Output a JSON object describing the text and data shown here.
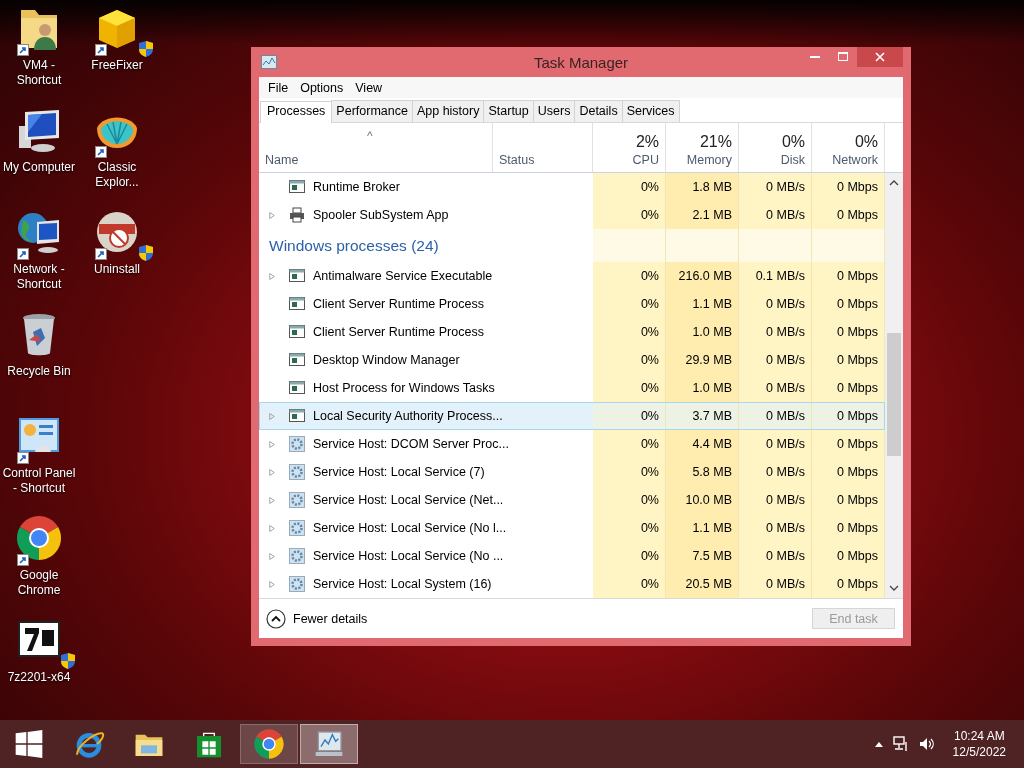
{
  "desktop_icons": [
    {
      "label": "VM4 - Shortcut",
      "kind": "user-folder",
      "shortcut": true,
      "shield": false
    },
    {
      "label": "My Computer",
      "kind": "computer",
      "shortcut": false,
      "shield": false
    },
    {
      "label": "Network - Shortcut",
      "kind": "network",
      "shortcut": true,
      "shield": false
    },
    {
      "label": "Recycle Bin",
      "kind": "recycle-bin",
      "shortcut": false,
      "shield": false
    },
    {
      "label": "Control Panel - Shortcut",
      "kind": "control-panel",
      "shortcut": true,
      "shield": false
    },
    {
      "label": "Google Chrome",
      "kind": "chrome",
      "shortcut": true,
      "shield": false
    },
    {
      "label": "7z2201-x64",
      "kind": "archive",
      "shortcut": false,
      "shield": true
    },
    {
      "label": "FreeFixer",
      "kind": "box-app",
      "shortcut": true,
      "shield": true
    },
    {
      "label": "Classic Explor...",
      "kind": "shell",
      "shortcut": true,
      "shield": false
    },
    {
      "label": "Uninstall",
      "kind": "installer",
      "shortcut": true,
      "shield": true
    }
  ],
  "window": {
    "title": "Task Manager",
    "menu": [
      "File",
      "Options",
      "View"
    ],
    "tabs": [
      {
        "label": "Processes",
        "selected": true
      },
      {
        "label": "Performance",
        "selected": false
      },
      {
        "label": "App history",
        "selected": false
      },
      {
        "label": "Startup",
        "selected": false
      },
      {
        "label": "Users",
        "selected": false
      },
      {
        "label": "Details",
        "selected": false
      },
      {
        "label": "Services",
        "selected": false
      }
    ],
    "sort_indicator": "^",
    "columns": [
      {
        "label": "Name"
      },
      {
        "label": "Status"
      },
      {
        "label": "CPU",
        "total": "2%"
      },
      {
        "label": "Memory",
        "total": "21%"
      },
      {
        "label": "Disk",
        "total": "0%"
      },
      {
        "label": "Network",
        "total": "0%"
      }
    ],
    "rows": [
      {
        "kind": "window",
        "name": "Runtime Broker",
        "expandable": false,
        "selected": false,
        "cpu": "0%",
        "memory": "1.8 MB",
        "disk": "0 MB/s",
        "network": "0 Mbps"
      },
      {
        "kind": "printer",
        "name": "Spooler SubSystem App",
        "expandable": true,
        "selected": false,
        "cpu": "0%",
        "memory": "2.1 MB",
        "disk": "0 MB/s",
        "network": "0 Mbps"
      },
      {
        "kind": "group",
        "name": "Windows processes (24)"
      },
      {
        "kind": "window",
        "name": "Antimalware Service Executable",
        "expandable": true,
        "selected": false,
        "cpu": "0%",
        "memory": "216.0 MB",
        "disk": "0.1 MB/s",
        "network": "0 Mbps"
      },
      {
        "kind": "window",
        "name": "Client Server Runtime Process",
        "expandable": false,
        "selected": false,
        "cpu": "0%",
        "memory": "1.1 MB",
        "disk": "0 MB/s",
        "network": "0 Mbps"
      },
      {
        "kind": "window",
        "name": "Client Server Runtime Process",
        "expandable": false,
        "selected": false,
        "cpu": "0%",
        "memory": "1.0 MB",
        "disk": "0 MB/s",
        "network": "0 Mbps"
      },
      {
        "kind": "window",
        "name": "Desktop Window Manager",
        "expandable": false,
        "selected": false,
        "cpu": "0%",
        "memory": "29.9 MB",
        "disk": "0 MB/s",
        "network": "0 Mbps"
      },
      {
        "kind": "window",
        "name": "Host Process for Windows Tasks",
        "expandable": false,
        "selected": false,
        "cpu": "0%",
        "memory": "1.0 MB",
        "disk": "0 MB/s",
        "network": "0 Mbps"
      },
      {
        "kind": "window",
        "name": "Local Security Authority Process...",
        "expandable": true,
        "selected": true,
        "cpu": "0%",
        "memory": "3.7 MB",
        "disk": "0 MB/s",
        "network": "0 Mbps"
      },
      {
        "kind": "service",
        "name": "Service Host: DCOM Server Proc...",
        "expandable": true,
        "selected": false,
        "cpu": "0%",
        "memory": "4.4 MB",
        "disk": "0 MB/s",
        "network": "0 Mbps"
      },
      {
        "kind": "service",
        "name": "Service Host: Local Service (7)",
        "expandable": true,
        "selected": false,
        "cpu": "0%",
        "memory": "5.8 MB",
        "disk": "0 MB/s",
        "network": "0 Mbps"
      },
      {
        "kind": "service",
        "name": "Service Host: Local Service (Net...",
        "expandable": true,
        "selected": false,
        "cpu": "0%",
        "memory": "10.0 MB",
        "disk": "0 MB/s",
        "network": "0 Mbps"
      },
      {
        "kind": "service",
        "name": "Service Host: Local Service (No l...",
        "expandable": true,
        "selected": false,
        "cpu": "0%",
        "memory": "1.1 MB",
        "disk": "0 MB/s",
        "network": "0 Mbps"
      },
      {
        "kind": "service",
        "name": "Service Host: Local Service (No ...",
        "expandable": true,
        "selected": false,
        "cpu": "0%",
        "memory": "7.5 MB",
        "disk": "0 MB/s",
        "network": "0 Mbps"
      },
      {
        "kind": "service",
        "name": "Service Host: Local System (16)",
        "expandable": true,
        "selected": false,
        "cpu": "0%",
        "memory": "20.5 MB",
        "disk": "0 MB/s",
        "network": "0 Mbps"
      }
    ],
    "fewer_details": "Fewer details",
    "end_task": {
      "label": "End task",
      "disabled": true
    }
  },
  "taskbar": {
    "items": [
      {
        "kind": "start",
        "running": false,
        "focused": false
      },
      {
        "kind": "ie",
        "running": false,
        "focused": false
      },
      {
        "kind": "explorer",
        "running": false,
        "focused": false
      },
      {
        "kind": "store",
        "running": false,
        "focused": false
      },
      {
        "kind": "chrome",
        "running": true,
        "focused": false
      },
      {
        "kind": "monitor",
        "running": true,
        "focused": true
      }
    ],
    "time": "10:24 AM",
    "date": "12/5/2022"
  }
}
